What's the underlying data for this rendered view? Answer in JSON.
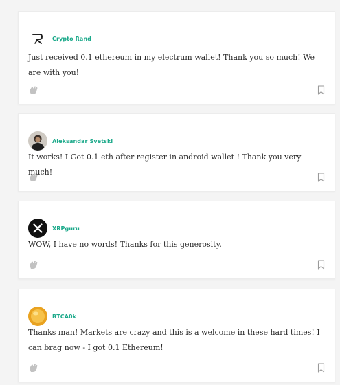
{
  "posts": [
    {
      "author": "Crypto Rand",
      "avatar_icon": "crypto-rand-logo",
      "text": "Just received 0.1 ethereum in my electrum wallet! Thank you so much! We are with you!"
    },
    {
      "author": "Aleksandar Svetski",
      "avatar_icon": "profile-photo",
      "text": "It works! I Got 0.1 eth  after register in android wallet ! Thank you very much!"
    },
    {
      "author": "XRPguru",
      "avatar_icon": "xrp-logo",
      "text": "WOW, I have no words! Thanks for this generosity."
    },
    {
      "author": "BTCA0k",
      "avatar_icon": "gold-coin",
      "text": "Thanks man! Markets are crazy and this is a welcome in these hard times! I can brag now - I got 0.1 Ethereum!"
    }
  ],
  "colors": {
    "author": "#1ba98a",
    "background": "#f4f4f4",
    "card": "#ffffff",
    "icon": "#b5b5b5"
  }
}
